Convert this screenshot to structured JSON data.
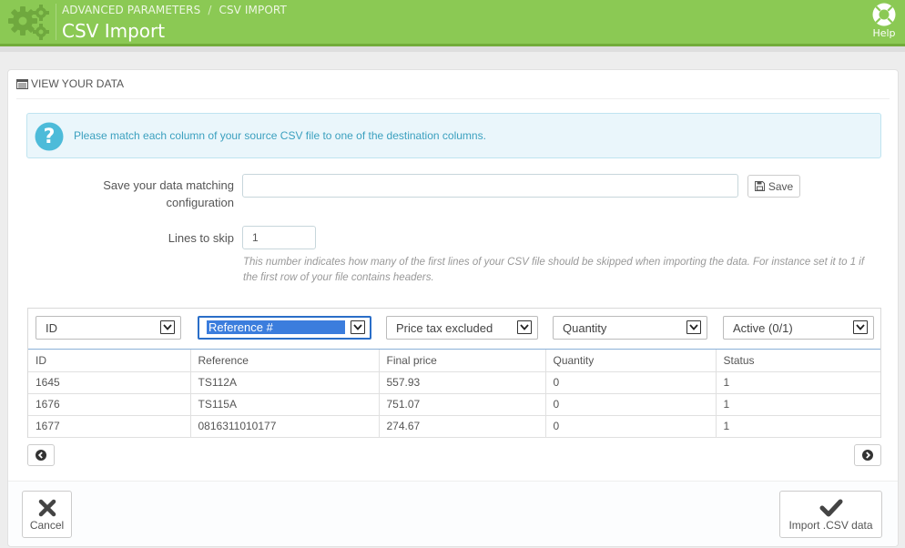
{
  "header": {
    "breadcrumb": [
      "ADVANCED PARAMETERS",
      "CSV IMPORT"
    ],
    "breadcrumb_separator": "/",
    "title": "CSV Import",
    "help_label": "Help",
    "colors": {
      "bar": "#8bc954",
      "bar_border": "#72ac3a"
    }
  },
  "panel": {
    "heading": "VIEW YOUR DATA",
    "heading_icon": "table-icon",
    "alert": {
      "icon": "question-circle-icon",
      "text": "Please match each column of your source CSV file to one of the destination columns."
    },
    "config": {
      "label": "Save your data matching configuration",
      "value": "",
      "save_label": "Save"
    },
    "skip": {
      "label": "Lines to skip",
      "value": "1",
      "help": "This number indicates how many of the first lines of your CSV file should be skipped when importing the data. For instance set it to 1 if the first row of your file contains headers."
    },
    "column_selects": [
      "ID",
      "Reference #",
      "Price tax excluded",
      "Quantity",
      "Active (0/1)"
    ],
    "table": {
      "headers": [
        "ID",
        "Reference",
        "Final price",
        "Quantity",
        "Status"
      ],
      "rows": [
        [
          "1645",
          "TS112A",
          "557.93",
          "0",
          "1"
        ],
        [
          "1676",
          "TS115A",
          "751.07",
          "0",
          "1"
        ],
        [
          "1677",
          "0816311010177",
          "274.67",
          "0",
          "1"
        ]
      ]
    },
    "footer": {
      "cancel_label": "Cancel",
      "import_label": "Import .CSV data"
    }
  }
}
